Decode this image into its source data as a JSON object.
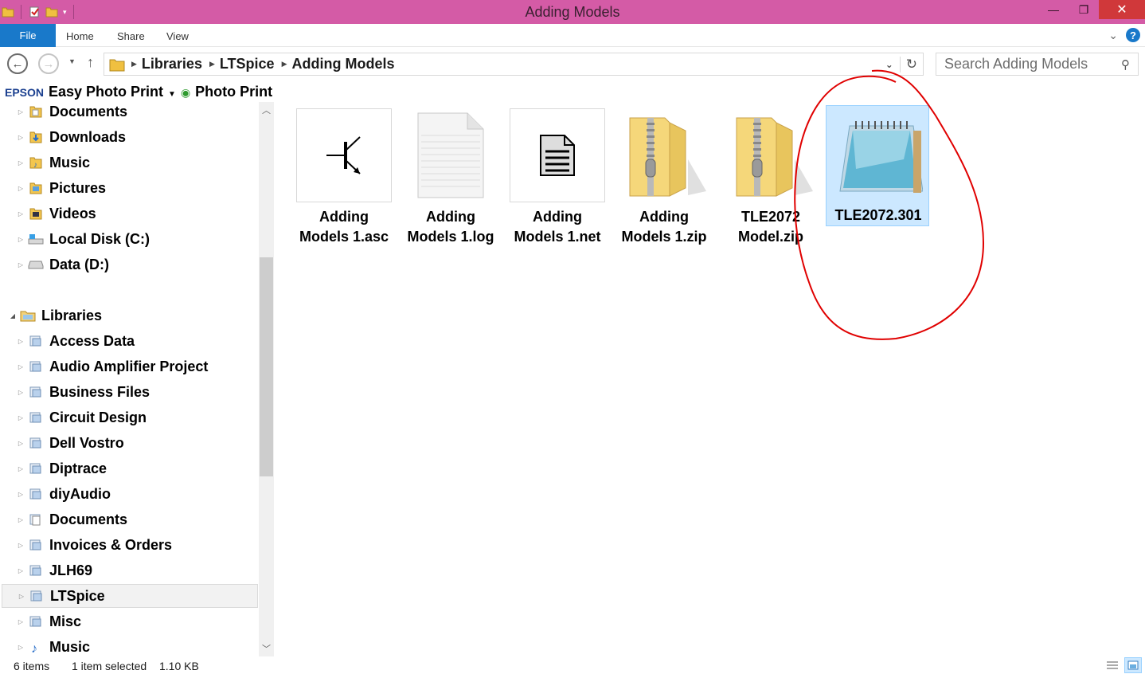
{
  "window": {
    "title": "Adding Models"
  },
  "ribbon": {
    "file": "File",
    "tabs": [
      "Home",
      "Share",
      "View"
    ]
  },
  "address": {
    "path": [
      "Libraries",
      "LTSpice",
      "Adding Models"
    ],
    "search_placeholder": "Search Adding Models"
  },
  "sidebar": {
    "epson": {
      "brand": "EPSON",
      "item1": "Easy Photo Print",
      "item2": "Photo Print"
    },
    "items": [
      {
        "label": "Documents",
        "icon": "documents-folder-icon"
      },
      {
        "label": "Downloads",
        "icon": "downloads-folder-icon"
      },
      {
        "label": "Music",
        "icon": "music-folder-icon"
      },
      {
        "label": "Pictures",
        "icon": "pictures-folder-icon"
      },
      {
        "label": "Videos",
        "icon": "videos-folder-icon"
      },
      {
        "label": "Local Disk (C:)",
        "icon": "local-disk-icon"
      },
      {
        "label": "Data (D:)",
        "icon": "drive-icon"
      },
      {
        "label": "Libraries",
        "icon": "libraries-icon"
      },
      {
        "label": "Access Data",
        "icon": "library-icon"
      },
      {
        "label": "Audio Amplifier Project",
        "icon": "library-icon"
      },
      {
        "label": "Business Files",
        "icon": "library-icon"
      },
      {
        "label": "Circuit Design",
        "icon": "library-icon"
      },
      {
        "label": "Dell Vostro",
        "icon": "library-icon"
      },
      {
        "label": "Diptrace",
        "icon": "library-icon"
      },
      {
        "label": "diyAudio",
        "icon": "library-icon"
      },
      {
        "label": "Documents",
        "icon": "library-documents-icon"
      },
      {
        "label": "Invoices & Orders",
        "icon": "library-icon"
      },
      {
        "label": "JLH69",
        "icon": "library-icon"
      },
      {
        "label": "LTSpice",
        "icon": "library-icon"
      },
      {
        "label": "Misc",
        "icon": "library-icon"
      },
      {
        "label": "Music",
        "icon": "library-music-icon"
      }
    ]
  },
  "files": [
    {
      "name": "Adding\nModels 1.asc",
      "icon": "ltspice-schematic-icon"
    },
    {
      "name": "Adding\nModels 1.log",
      "icon": "text-document-icon"
    },
    {
      "name": "Adding\nModels 1.net",
      "icon": "netlist-document-icon"
    },
    {
      "name": "Adding\nModels 1.zip",
      "icon": "zip-folder-icon"
    },
    {
      "name": "TLE2072\nModel.zip",
      "icon": "zip-folder-icon"
    },
    {
      "name": "TLE2072.301",
      "icon": "notepad-icon"
    }
  ],
  "status": {
    "count": "6 items",
    "selection": "1 item selected",
    "size": "1.10 KB"
  },
  "colors": {
    "titlebar": "#d45ba6",
    "accent": "#1979ca",
    "selection": "#cce8ff",
    "annotation": "#e00000"
  }
}
